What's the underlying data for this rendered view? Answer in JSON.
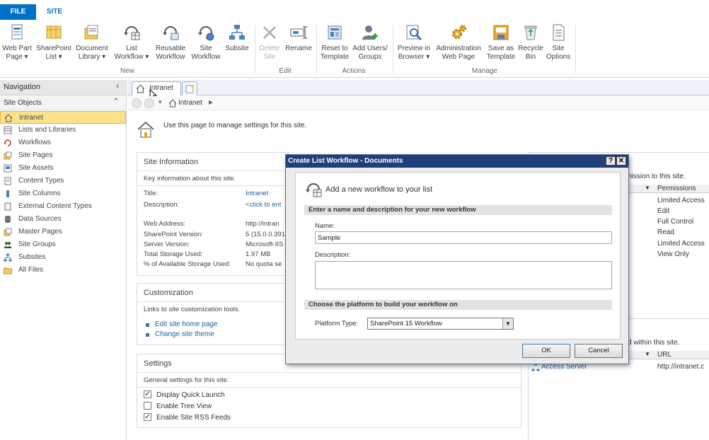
{
  "ribbon": {
    "tabs": {
      "file": "FILE",
      "site": "SITE"
    },
    "groups": {
      "new": "New",
      "edit": "Edit",
      "actions": "Actions",
      "manage": "Manage"
    },
    "buttons": {
      "web_part_page": [
        "Web Part",
        "Page ▾"
      ],
      "sharepoint_list": [
        "SharePoint",
        "List ▾"
      ],
      "document_library": [
        "Document",
        "Library ▾"
      ],
      "list_workflow": [
        "List",
        "Workflow ▾"
      ],
      "reusable_workflow": [
        "Reusable",
        "Workflow"
      ],
      "site_workflow": [
        "Site",
        "Workflow"
      ],
      "subsite": [
        "Subsite",
        ""
      ],
      "delete_site": [
        "Delete",
        "Site"
      ],
      "rename": [
        "Rename",
        ""
      ],
      "reset_to_template": [
        "Reset to",
        "Template"
      ],
      "add_users_groups": [
        "Add Users/",
        "Groups"
      ],
      "preview_in_browser": [
        "Preview in",
        "Browser ▾"
      ],
      "administration_web_page": [
        "Administration",
        "Web Page"
      ],
      "save_as_template": [
        "Save as",
        "Template"
      ],
      "recycle_bin": [
        "Recycle",
        "Bin"
      ],
      "site_options": [
        "Site",
        "Options"
      ]
    }
  },
  "nav": {
    "header": "Navigation",
    "section": "Site Objects",
    "items": [
      "Intranet",
      "Lists and Libraries",
      "Workflows",
      "Site Pages",
      "Site Assets",
      "Content Types",
      "Site Columns",
      "External Content Types",
      "Data Sources",
      "Master Pages",
      "Site Groups",
      "Subsites",
      "All Files"
    ]
  },
  "doc_tab": {
    "label": "Intranet"
  },
  "breadcrumb": {
    "text": "Intranet"
  },
  "intro": "Use this page to manage settings for this site.",
  "site_info": {
    "title": "Site Information",
    "desc": "Key information about this site.",
    "rows": [
      {
        "label": "Title:",
        "value": "Intranet"
      },
      {
        "label": "Description:",
        "value": "<click to ent"
      },
      {
        "label": "Web Address:",
        "value": "http://intran"
      },
      {
        "label": "SharePoint Version:",
        "value": "5 (15.0.0.391"
      },
      {
        "label": "Server Version:",
        "value": "Microsoft-IIS"
      },
      {
        "label": "Total Storage Used:",
        "value": "1.97 MB"
      },
      {
        "label": "% of Available Storage Used:",
        "value": "No quota se"
      }
    ]
  },
  "customization": {
    "title": "Customization",
    "desc": "Links to site customization tools.",
    "links": [
      "Edit site home page",
      "Change site theme"
    ]
  },
  "settings": {
    "title": "Settings",
    "desc": "General settings for this site.",
    "options": [
      {
        "label": "Display Quick Launch",
        "checked": true
      },
      {
        "label": "Enable Tree View",
        "checked": false
      },
      {
        "label": "Enable Site RSS Feeds",
        "checked": true
      }
    ]
  },
  "permissions": {
    "desc_partial": "nission to this site.",
    "column": "Permissions",
    "values": [
      "Limited Access",
      "Edit",
      "Full Control",
      "Read",
      "Limited Access",
      "View Only"
    ]
  },
  "subsites": {
    "desc_partial": "d within this site.",
    "column": "URL",
    "row_name": "Access Server",
    "row_url": "http://intranet.c"
  },
  "dialog": {
    "title": "Create List Workflow - Documents",
    "help_btn": "?",
    "close_btn": "✕",
    "heading": "Add a new workflow to your list",
    "section_name": "Enter a name and description for your new workflow",
    "name_label": "Name:",
    "name_value": "Sample",
    "desc_label": "Description:",
    "section_platform": "Choose the platform to build your workflow on",
    "platform_label": "Platform Type:",
    "platform_value": "SharePoint 15 Workflow",
    "ok": "OK",
    "cancel": "Cancel"
  }
}
